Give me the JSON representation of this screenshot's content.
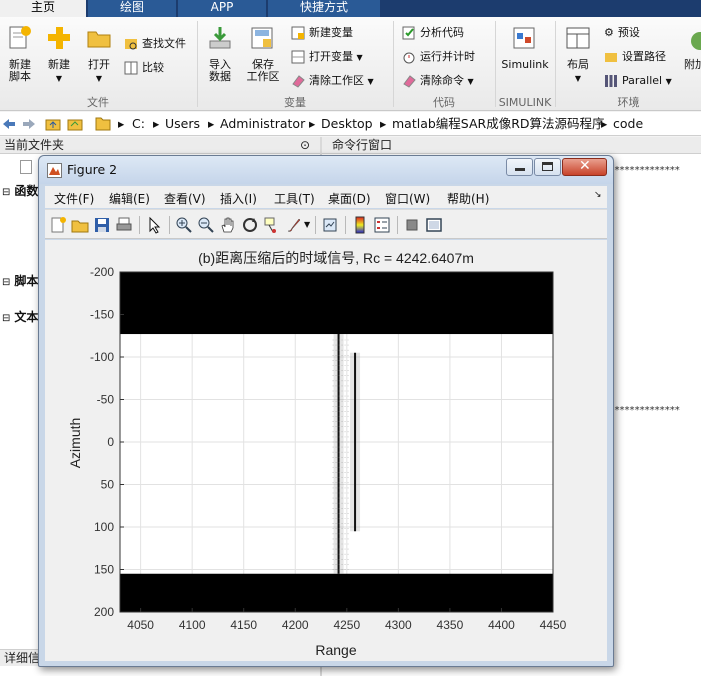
{
  "tabs": [
    {
      "label": "主页",
      "active": true
    },
    {
      "label": "绘图",
      "active": false
    },
    {
      "label": "APP",
      "active": false
    },
    {
      "label": "快捷方式",
      "active": false
    }
  ],
  "ribbon": {
    "file_group": {
      "label": "文件",
      "new_script": "新建\n脚本",
      "new": "新建",
      "open": "打开",
      "find_files": "查找文件",
      "compare": "比较"
    },
    "variable_group": {
      "label": "变量",
      "import_data": "导入\n数据",
      "save_workspace": "保存\n工作区",
      "new_variable": "新建变量",
      "open_variable": "打开变量",
      "clear_workspace": "清除工作区"
    },
    "code_group": {
      "label": "代码",
      "analyze_code": "分析代码",
      "run_and_time": "运行并计时",
      "clear_commands": "清除命令"
    },
    "simulink_group": {
      "label": "SIMULINK",
      "simulink": "Simulink"
    },
    "env_group": {
      "label": "环境",
      "layout": "布局",
      "preferences": "预设",
      "set_path": "设置路径",
      "parallel": "Parallel",
      "addons": "附加"
    }
  },
  "address": {
    "crumbs": [
      "C:",
      "Users",
      "Administrator",
      "Desktop",
      "matlab编程SAR成像RD算法源码程序",
      "code"
    ]
  },
  "panes": {
    "current_folder": "当前文件夹",
    "command_window": "命令行窗口",
    "left_rows": [
      "函数",
      "脚本",
      "文本"
    ],
    "details": "详细信",
    "stars": "*************"
  },
  "figure": {
    "title": "Figure 2",
    "menus": [
      "文件(F)",
      "编辑(E)",
      "查看(V)",
      "插入(I)",
      "工具(T)",
      "桌面(D)",
      "窗口(W)",
      "帮助(H)"
    ]
  },
  "chart_data": {
    "type": "heatmap",
    "title": "(b)距离压缩后的时域信号, Rc = 4242.6407m",
    "xlabel": "Range",
    "ylabel": "Azimuth",
    "xlim": [
      4030,
      4450
    ],
    "ylim": [
      -200,
      200
    ],
    "y_reversed": true,
    "x_ticks": [
      4050,
      4100,
      4150,
      4200,
      4250,
      4300,
      4350,
      4400,
      4450
    ],
    "y_ticks": [
      -200,
      -150,
      -100,
      -50,
      0,
      50,
      100,
      150,
      200
    ],
    "grid": true,
    "colormap": "gray",
    "black_bands": [
      [
        -200,
        -127
      ],
      [
        155,
        200
      ]
    ],
    "targets": [
      {
        "range": 4242,
        "azimuth_from": -127,
        "azimuth_to": 155
      },
      {
        "range": 4258,
        "azimuth_from": -105,
        "azimuth_to": 105
      }
    ]
  },
  "colors": {
    "tab_bar": "#1c3c6e",
    "figure_frame": "#c9d7e8"
  }
}
